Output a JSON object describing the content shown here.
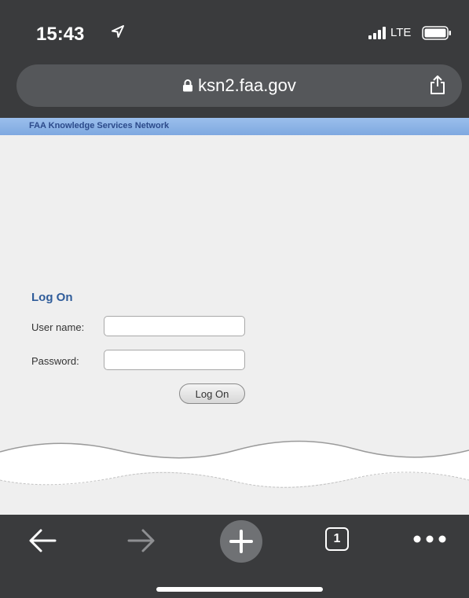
{
  "status_bar": {
    "time": "15:43",
    "location_icon": "location-arrow-icon",
    "signal_icon": "cellular-signal-icon",
    "network": "LTE",
    "battery_icon": "battery-icon"
  },
  "browser": {
    "url": "ksn2.faa.gov",
    "lock_icon": "lock-icon",
    "share_icon": "share-icon"
  },
  "page": {
    "banner_title": "FAA Knowledge Services Network",
    "logon": {
      "title": "Log On",
      "username_label": "User name:",
      "username_value": "",
      "password_label": "Password:",
      "password_value": "",
      "submit_label": "Log On"
    }
  },
  "toolbar": {
    "back_icon": "back-arrow-icon",
    "forward_icon": "forward-arrow-icon",
    "new_tab_icon": "plus-icon",
    "tab_count": "1",
    "more_icon": "more-dots-icon"
  },
  "colors": {
    "chrome_dark": "#3a3b3d",
    "url_pill": "#55575a",
    "banner_blue": "#8db3e6",
    "logon_title": "#2f5c9a",
    "page_bg": "#efefef"
  }
}
